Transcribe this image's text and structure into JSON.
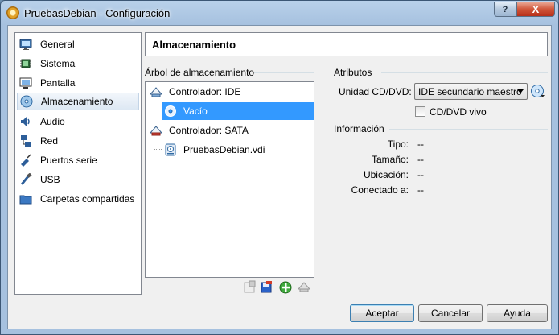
{
  "window": {
    "title": "PruebasDebian - Configuración",
    "help_glyph": "?",
    "close_glyph": "X"
  },
  "sidebar": {
    "items": [
      {
        "label": "General",
        "icon": "monitor-icon",
        "selected": false
      },
      {
        "label": "Sistema",
        "icon": "chip-icon",
        "selected": false
      },
      {
        "label": "Pantalla",
        "icon": "display-icon",
        "selected": false
      },
      {
        "label": "Almacenamiento",
        "icon": "disk-icon",
        "selected": true
      },
      {
        "label": "Audio",
        "icon": "speaker-icon",
        "selected": false
      },
      {
        "label": "Red",
        "icon": "network-icon",
        "selected": false
      },
      {
        "label": "Puertos serie",
        "icon": "serial-port-icon",
        "selected": false
      },
      {
        "label": "USB",
        "icon": "usb-icon",
        "selected": false
      },
      {
        "label": "Carpetas compartidas",
        "icon": "folder-icon",
        "selected": false
      }
    ]
  },
  "page": {
    "title": "Almacenamiento"
  },
  "tree": {
    "group_label": "Árbol de almacenamiento",
    "ide_controller": "Controlador: IDE",
    "ide_child": "Vacío",
    "sata_controller": "Controlador: SATA",
    "sata_child": "PruebasDebian.vdi"
  },
  "attributes": {
    "group_label": "Atributos",
    "drive_label": "Unidad CD/DVD:",
    "drive_value": "IDE secundario maestro",
    "live_label": "CD/DVD vivo",
    "live_checked": false
  },
  "information": {
    "group_label": "Información",
    "rows": [
      {
        "label": "Tipo:",
        "value": "--"
      },
      {
        "label": "Tamaño:",
        "value": "--"
      },
      {
        "label": "Ubicación:",
        "value": "--"
      },
      {
        "label": "Conectado a:",
        "value": "--"
      }
    ]
  },
  "buttons": {
    "accept": "Aceptar",
    "cancel": "Cancelar",
    "help": "Ayuda"
  },
  "colors": {
    "selection": "#3399ff",
    "frame": "#a6c1df"
  }
}
